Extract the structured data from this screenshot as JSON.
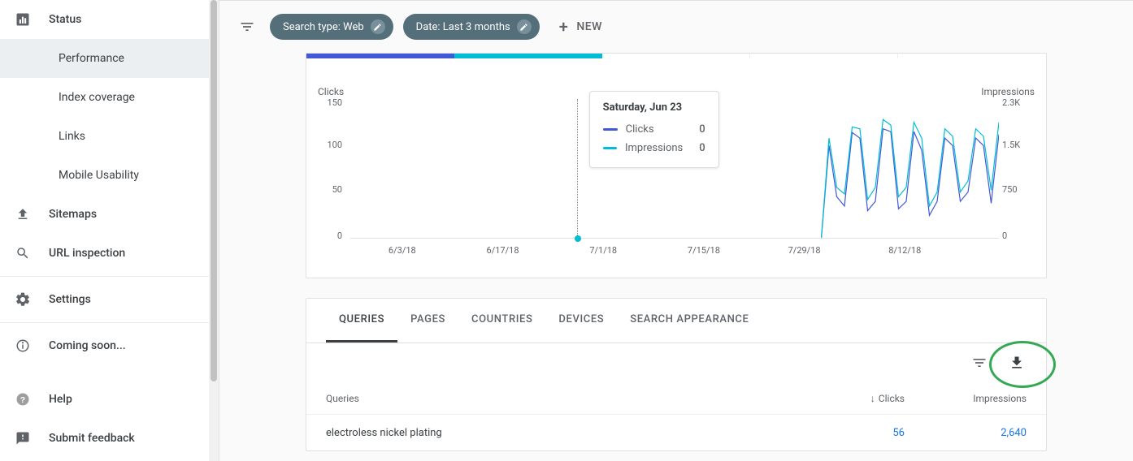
{
  "sidebar": {
    "status": "Status",
    "performance": "Performance",
    "index_coverage": "Index coverage",
    "links": "Links",
    "mobile_usability": "Mobile Usability",
    "sitemaps": "Sitemaps",
    "url_inspection": "URL inspection",
    "settings": "Settings",
    "coming_soon": "Coming soon...",
    "help": "Help",
    "submit_feedback": "Submit feedback"
  },
  "filters": {
    "search_type": "Search type: Web",
    "date_range": "Date: Last 3 months",
    "new_label": "NEW"
  },
  "chart": {
    "left_axis": "Clicks",
    "right_axis": "Impressions",
    "tooltip_title": "Saturday, Jun 23",
    "tooltip_clicks_label": "Clicks",
    "tooltip_clicks_val": "0",
    "tooltip_impr_label": "Impressions",
    "tooltip_impr_val": "0"
  },
  "chart_data": {
    "type": "line",
    "xlabel": "",
    "ylabel_left": "Clicks",
    "ylabel_right": "Impressions",
    "ylim_left": [
      0,
      150
    ],
    "ylim_right": [
      0,
      2300
    ],
    "y_ticks_left": [
      "150",
      "100",
      "50",
      "0"
    ],
    "y_ticks_right": [
      "2.3K",
      "1.5K",
      "750",
      "0"
    ],
    "x_ticks": [
      "6/3/18",
      "6/17/18",
      "7/1/18",
      "7/15/18",
      "7/29/18",
      "8/12/18"
    ],
    "x_tick_pos": [
      8,
      23.5,
      39,
      54.5,
      70,
      85.5
    ],
    "series": [
      {
        "name": "Clicks",
        "color": "#4259d6",
        "axis": "left",
        "values": [
          0,
          0,
          0,
          0,
          0,
          0,
          0,
          0,
          0,
          0,
          0,
          0,
          0,
          0,
          0,
          0,
          0,
          0,
          0,
          0,
          0,
          0,
          0,
          0,
          0,
          0,
          0,
          0,
          0,
          0,
          0,
          0,
          0,
          0,
          0,
          0,
          0,
          0,
          0,
          0,
          0,
          0,
          0,
          0,
          0,
          0,
          0,
          0,
          0,
          0,
          0,
          0,
          0,
          0,
          0,
          0,
          0,
          0,
          0,
          0,
          0,
          0,
          100,
          45,
          35,
          114,
          108,
          30,
          40,
          118,
          115,
          32,
          40,
          115,
          95,
          25,
          40,
          108,
          100,
          40,
          50,
          108,
          100,
          38,
          112
        ]
      },
      {
        "name": "Impressions",
        "color": "#00bcd4",
        "axis": "left",
        "values": [
          0,
          0,
          0,
          0,
          0,
          0,
          0,
          0,
          0,
          0,
          0,
          0,
          0,
          0,
          0,
          0,
          0,
          0,
          0,
          0,
          0,
          0,
          0,
          0,
          0,
          0,
          0,
          0,
          0,
          0,
          0,
          0,
          0,
          0,
          0,
          0,
          0,
          0,
          0,
          0,
          0,
          0,
          0,
          0,
          0,
          0,
          0,
          0,
          0,
          0,
          0,
          0,
          0,
          0,
          0,
          0,
          0,
          0,
          0,
          0,
          0,
          0,
          108,
          55,
          48,
          120,
          118,
          42,
          55,
          128,
          122,
          45,
          55,
          125,
          108,
          35,
          50,
          118,
          110,
          50,
          62,
          118,
          110,
          52,
          125
        ]
      }
    ]
  },
  "tabs": {
    "queries": "QUERIES",
    "pages": "PAGES",
    "countries": "COUNTRIES",
    "devices": "DEVICES",
    "appearance": "SEARCH APPEARANCE"
  },
  "table": {
    "header_queries": "Queries",
    "header_clicks": "Clicks",
    "header_impressions": "Impressions",
    "rows": [
      {
        "q": "electroless nickel plating",
        "clicks": "56",
        "impr": "2,640"
      }
    ]
  },
  "colors": {
    "clicks": "#4259d6",
    "impressions": "#00bcd4"
  }
}
